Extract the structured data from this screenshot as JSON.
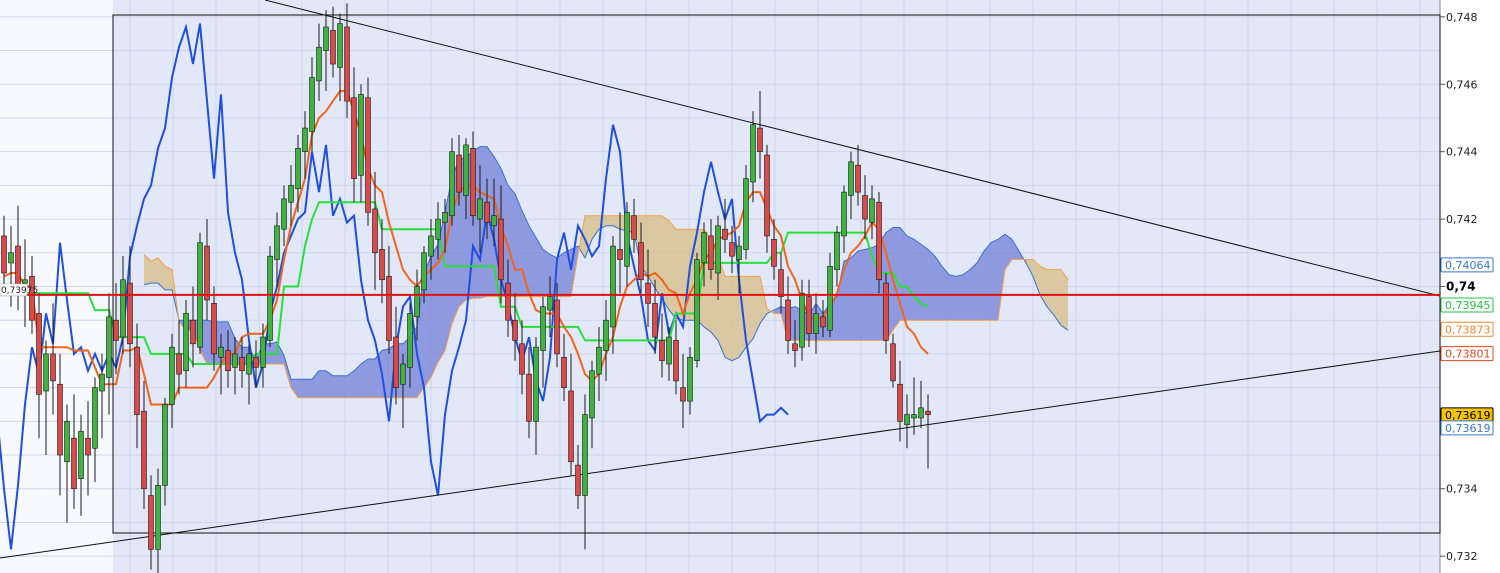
{
  "chart_data": {
    "type": "candlestick",
    "ylim": [
      0.7315,
      0.7485
    ],
    "y_ticks": [
      "0,748",
      "0,746",
      "0,744",
      "0,742",
      "0,74",
      "0,734",
      "0,732"
    ],
    "bold_tick": "0,74",
    "grid": true,
    "current_price_line": 0.73975,
    "price_tags": [
      {
        "label": "0,74064",
        "value": 0.74064,
        "color": "#3a78d0",
        "fill": "#ffffff"
      },
      {
        "label": "0,73945",
        "value": 0.73945,
        "color": "#22c444",
        "fill": "#ffffff"
      },
      {
        "label": "0,73873",
        "value": 0.73873,
        "color": "#f08a2e",
        "fill": "#ffffff"
      },
      {
        "label": "0,73801",
        "value": 0.73801,
        "color": "#e04a1a",
        "fill": "#ffffff"
      },
      {
        "label": "0,73619",
        "value": 0.73619,
        "color": "#000000",
        "fill": "#f5c400"
      },
      {
        "label": "0,73619",
        "value": 0.73619,
        "color": "#3a78d0",
        "fill": "#ffffff"
      }
    ],
    "left_tag": "0,73975",
    "series": [
      {
        "name": "price",
        "ohlc": [
          [
            0.7415,
            0.7421,
            0.7398,
            0.7404
          ],
          [
            0.7407,
            0.7418,
            0.7394,
            0.741
          ],
          [
            0.7412,
            0.7424,
            0.7393,
            0.7399
          ],
          [
            0.7401,
            0.7414,
            0.7388,
            0.7402
          ],
          [
            0.7403,
            0.7409,
            0.7386,
            0.739
          ],
          [
            0.7392,
            0.7398,
            0.7355,
            0.7368
          ],
          [
            0.7369,
            0.7384,
            0.735,
            0.738
          ],
          [
            0.738,
            0.7395,
            0.7362,
            0.7372
          ],
          [
            0.7371,
            0.738,
            0.7338,
            0.735
          ],
          [
            0.7348,
            0.7365,
            0.733,
            0.736
          ],
          [
            0.7355,
            0.7368,
            0.7334,
            0.734
          ],
          [
            0.7343,
            0.7362,
            0.7332,
            0.7357
          ],
          [
            0.7355,
            0.7366,
            0.7338,
            0.735
          ],
          [
            0.7352,
            0.7373,
            0.7342,
            0.737
          ],
          [
            0.7369,
            0.738,
            0.7355,
            0.7374
          ],
          [
            0.7373,
            0.7398,
            0.7362,
            0.7391
          ],
          [
            0.739,
            0.7401,
            0.7374,
            0.7384
          ],
          [
            0.7385,
            0.7409,
            0.738,
            0.7402
          ],
          [
            0.7401,
            0.7412,
            0.7376,
            0.7383
          ],
          [
            0.7382,
            0.7389,
            0.7352,
            0.7362
          ],
          [
            0.7363,
            0.7372,
            0.7334,
            0.734
          ],
          [
            0.7338,
            0.7344,
            0.7316,
            0.7322
          ],
          [
            0.7322,
            0.7346,
            0.731,
            0.7341
          ],
          [
            0.7341,
            0.7367,
            0.7335,
            0.7365
          ],
          [
            0.7365,
            0.7386,
            0.7358,
            0.7382
          ],
          [
            0.738,
            0.739,
            0.7368,
            0.7374
          ],
          [
            0.7375,
            0.7396,
            0.737,
            0.7392
          ],
          [
            0.739,
            0.74,
            0.7376,
            0.7383
          ],
          [
            0.7382,
            0.7416,
            0.738,
            0.7413
          ],
          [
            0.7412,
            0.742,
            0.739,
            0.7396
          ],
          [
            0.7395,
            0.74,
            0.7375,
            0.738
          ],
          [
            0.7379,
            0.7386,
            0.7368,
            0.7382
          ],
          [
            0.7381,
            0.7387,
            0.737,
            0.7375
          ],
          [
            0.7376,
            0.7385,
            0.7368,
            0.738
          ],
          [
            0.7379,
            0.7385,
            0.737,
            0.7375
          ],
          [
            0.7374,
            0.7383,
            0.7365,
            0.738
          ],
          [
            0.7379,
            0.7384,
            0.737,
            0.7376
          ],
          [
            0.7376,
            0.7389,
            0.737,
            0.7385
          ],
          [
            0.7384,
            0.7412,
            0.7382,
            0.7409
          ],
          [
            0.7408,
            0.7422,
            0.74,
            0.7418
          ],
          [
            0.7417,
            0.743,
            0.7412,
            0.7426
          ],
          [
            0.7425,
            0.7436,
            0.7418,
            0.743
          ],
          [
            0.7429,
            0.7445,
            0.7422,
            0.7441
          ],
          [
            0.744,
            0.7452,
            0.7432,
            0.7447
          ],
          [
            0.7446,
            0.7468,
            0.744,
            0.7462
          ],
          [
            0.7461,
            0.7478,
            0.7455,
            0.7471
          ],
          [
            0.747,
            0.7482,
            0.7458,
            0.7477
          ],
          [
            0.7476,
            0.7483,
            0.7462,
            0.7466
          ],
          [
            0.7465,
            0.7481,
            0.7455,
            0.7478
          ],
          [
            0.7477,
            0.7484,
            0.745,
            0.7455
          ],
          [
            0.7456,
            0.7465,
            0.7425,
            0.7432
          ],
          [
            0.7433,
            0.746,
            0.7425,
            0.7457
          ],
          [
            0.7456,
            0.7462,
            0.7418,
            0.7422
          ],
          [
            0.7423,
            0.7434,
            0.7399,
            0.741
          ],
          [
            0.7411,
            0.742,
            0.7395,
            0.7402
          ],
          [
            0.7403,
            0.7412,
            0.738,
            0.7384
          ],
          [
            0.7385,
            0.7394,
            0.7365,
            0.737
          ],
          [
            0.7371,
            0.738,
            0.7358,
            0.7377
          ],
          [
            0.7376,
            0.7395,
            0.737,
            0.7392
          ],
          [
            0.7391,
            0.7405,
            0.7384,
            0.74
          ],
          [
            0.7399,
            0.7412,
            0.7395,
            0.741
          ],
          [
            0.7409,
            0.742,
            0.7402,
            0.7415
          ],
          [
            0.7414,
            0.7425,
            0.7408,
            0.742
          ],
          [
            0.7419,
            0.7426,
            0.741,
            0.7422
          ],
          [
            0.7421,
            0.7444,
            0.7418,
            0.744
          ],
          [
            0.7439,
            0.7445,
            0.7424,
            0.7428
          ],
          [
            0.7427,
            0.7444,
            0.742,
            0.7442
          ],
          [
            0.7441,
            0.7446,
            0.7418,
            0.7421
          ],
          [
            0.742,
            0.7436,
            0.741,
            0.7426
          ],
          [
            0.7425,
            0.7432,
            0.7414,
            0.7419
          ],
          [
            0.7418,
            0.7432,
            0.7412,
            0.7421
          ],
          [
            0.742,
            0.743,
            0.7395,
            0.7402
          ],
          [
            0.7401,
            0.7408,
            0.7385,
            0.739
          ],
          [
            0.739,
            0.7398,
            0.7378,
            0.7384
          ],
          [
            0.7383,
            0.739,
            0.7368,
            0.7374
          ],
          [
            0.7374,
            0.7382,
            0.7355,
            0.736
          ],
          [
            0.736,
            0.7385,
            0.735,
            0.7382
          ],
          [
            0.7381,
            0.7397,
            0.737,
            0.7394
          ],
          [
            0.7393,
            0.7403,
            0.7385,
            0.7397
          ],
          [
            0.7396,
            0.7401,
            0.7376,
            0.738
          ],
          [
            0.7379,
            0.7386,
            0.7366,
            0.737
          ],
          [
            0.7369,
            0.738,
            0.7344,
            0.7348
          ],
          [
            0.7347,
            0.7353,
            0.7334,
            0.7338
          ],
          [
            0.7338,
            0.7368,
            0.7322,
            0.7362
          ],
          [
            0.7361,
            0.7378,
            0.7352,
            0.7375
          ],
          [
            0.7374,
            0.7388,
            0.7366,
            0.7382
          ],
          [
            0.7381,
            0.7396,
            0.7372,
            0.739
          ],
          [
            0.7388,
            0.7415,
            0.738,
            0.7412
          ],
          [
            0.7411,
            0.7422,
            0.7398,
            0.7408
          ],
          [
            0.7406,
            0.7425,
            0.74,
            0.7422
          ],
          [
            0.7421,
            0.7426,
            0.741,
            0.7414
          ],
          [
            0.7413,
            0.7419,
            0.7398,
            0.7402
          ],
          [
            0.7401,
            0.7411,
            0.7388,
            0.7395
          ],
          [
            0.7395,
            0.7402,
            0.738,
            0.7385
          ],
          [
            0.7384,
            0.7392,
            0.7373,
            0.7378
          ],
          [
            0.7377,
            0.7388,
            0.7372,
            0.7385
          ],
          [
            0.7384,
            0.739,
            0.7368,
            0.7372
          ],
          [
            0.737,
            0.738,
            0.7358,
            0.7366
          ],
          [
            0.7366,
            0.7382,
            0.7362,
            0.7379
          ],
          [
            0.7378,
            0.741,
            0.7376,
            0.7408
          ],
          [
            0.7407,
            0.7419,
            0.74,
            0.7416
          ],
          [
            0.7415,
            0.742,
            0.7402,
            0.7405
          ],
          [
            0.7404,
            0.7421,
            0.7396,
            0.7418
          ],
          [
            0.7417,
            0.7426,
            0.741,
            0.7414
          ],
          [
            0.7413,
            0.7418,
            0.7404,
            0.7409
          ],
          [
            0.7408,
            0.7415,
            0.7398,
            0.7412
          ],
          [
            0.7411,
            0.7436,
            0.7408,
            0.7432
          ],
          [
            0.7431,
            0.7452,
            0.7425,
            0.7448
          ],
          [
            0.7447,
            0.7458,
            0.7432,
            0.744
          ],
          [
            0.7439,
            0.7442,
            0.741,
            0.7415
          ],
          [
            0.7414,
            0.742,
            0.7402,
            0.7406
          ],
          [
            0.7405,
            0.741,
            0.7392,
            0.7397
          ],
          [
            0.7396,
            0.7403,
            0.738,
            0.7384
          ],
          [
            0.7383,
            0.739,
            0.7376,
            0.7381
          ],
          [
            0.7382,
            0.7402,
            0.7378,
            0.7398
          ],
          [
            0.7397,
            0.7402,
            0.7382,
            0.7386
          ],
          [
            0.7386,
            0.7398,
            0.738,
            0.7392
          ],
          [
            0.7391,
            0.7396,
            0.7385,
            0.7388
          ],
          [
            0.7387,
            0.741,
            0.7385,
            0.7406
          ],
          [
            0.7405,
            0.7418,
            0.74,
            0.7416
          ],
          [
            0.7415,
            0.743,
            0.741,
            0.7428
          ],
          [
            0.7427,
            0.744,
            0.742,
            0.7437
          ],
          [
            0.7436,
            0.7442,
            0.7424,
            0.7428
          ],
          [
            0.7427,
            0.7433,
            0.7414,
            0.742
          ],
          [
            0.7419,
            0.743,
            0.7414,
            0.7426
          ],
          [
            0.7425,
            0.7428,
            0.7398,
            0.7402
          ],
          [
            0.7401,
            0.7404,
            0.738,
            0.7384
          ],
          [
            0.7383,
            0.7386,
            0.737,
            0.7372
          ],
          [
            0.7371,
            0.7378,
            0.7354,
            0.736
          ],
          [
            0.7359,
            0.7368,
            0.7352,
            0.7362
          ],
          [
            0.7361,
            0.7373,
            0.7356,
            0.7362
          ],
          [
            0.7361,
            0.7372,
            0.7358,
            0.7364
          ],
          [
            0.7363,
            0.7368,
            0.7346,
            0.7362
          ]
        ]
      },
      {
        "name": "tenkan",
        "values": [
          0.7403,
          0.7404,
          0.7404,
          0.74,
          0.74,
          0.7382,
          0.7382,
          0.7382,
          0.7382,
          0.7382,
          0.7381,
          0.7381,
          0.7381,
          0.7376,
          0.7371,
          0.7371,
          0.7371,
          0.7381,
          0.7381,
          0.7382,
          0.7374,
          0.7365,
          0.7365,
          0.7365,
          0.7365,
          0.737,
          0.737,
          0.737,
          0.737,
          0.737,
          0.7373,
          0.7377,
          0.738,
          0.738,
          0.7385,
          0.7386,
          0.7386,
          0.7386,
          0.739,
          0.7396,
          0.7408,
          0.7418,
          0.7425,
          0.7432,
          0.7445,
          0.745,
          0.7452,
          0.7455,
          0.7458,
          0.7458,
          0.7452,
          0.7445,
          0.7435,
          0.743,
          0.7428,
          0.7419,
          0.7412,
          0.7405,
          0.7402,
          0.74,
          0.7403,
          0.7405,
          0.7407,
          0.7411,
          0.7422,
          0.7428,
          0.743,
          0.743,
          0.7428,
          0.7427,
          0.7426,
          0.7418,
          0.7412,
          0.7405,
          0.7405,
          0.7398,
          0.7393,
          0.7392,
          0.7392,
          0.7392,
          0.7388,
          0.7385,
          0.738,
          0.7374,
          0.7372,
          0.7374,
          0.738,
          0.7385,
          0.7394,
          0.74,
          0.7402,
          0.7404,
          0.7403,
          0.7404,
          0.7402,
          0.7399,
          0.7398,
          0.7392,
          0.7398,
          0.7402,
          0.7408,
          0.741,
          0.7414,
          0.7415,
          0.7416,
          0.7418,
          0.7425,
          0.7428,
          0.7428,
          0.7423,
          0.7418,
          0.7415,
          0.7406,
          0.7402,
          0.7396,
          0.7391,
          0.739,
          0.7391,
          0.7394,
          0.7398,
          0.7405,
          0.741,
          0.7412,
          0.7415,
          0.7419,
          0.7417,
          0.741,
          0.7402,
          0.7395,
          0.7388,
          0.7386,
          0.7382,
          0.738
        ]
      },
      {
        "name": "kijun",
        "values": [
          0.7398,
          0.7398,
          0.7398,
          0.7398,
          0.7398,
          0.7398,
          0.7398,
          0.7398,
          0.7398,
          0.7398,
          0.7398,
          0.7398,
          0.7398,
          0.7393,
          0.7393,
          0.7393,
          0.7385,
          0.7385,
          0.7385,
          0.7385,
          0.7385,
          0.738,
          0.738,
          0.738,
          0.738,
          0.738,
          0.738,
          0.7377,
          0.7377,
          0.7377,
          0.7377,
          0.7377,
          0.7377,
          0.7377,
          0.7377,
          0.7377,
          0.738,
          0.738,
          0.738,
          0.738,
          0.74,
          0.74,
          0.74,
          0.7412,
          0.742,
          0.7425,
          0.7425,
          0.7425,
          0.7425,
          0.7425,
          0.7425,
          0.7425,
          0.7425,
          0.7425,
          0.7417,
          0.7417,
          0.7417,
          0.7417,
          0.7417,
          0.7417,
          0.7417,
          0.7417,
          0.7417,
          0.7406,
          0.7406,
          0.7406,
          0.7406,
          0.7406,
          0.7406,
          0.7406,
          0.7406,
          0.7394,
          0.7394,
          0.7394,
          0.7388,
          0.7388,
          0.7388,
          0.7388,
          0.7388,
          0.7388,
          0.7388,
          0.7388,
          0.7388,
          0.7384,
          0.7384,
          0.7384,
          0.7384,
          0.7384,
          0.7384,
          0.7384,
          0.7384,
          0.7384,
          0.7384,
          0.7384,
          0.7384,
          0.7384,
          0.7392,
          0.7392,
          0.7392,
          0.7392,
          0.7407,
          0.7407,
          0.7407,
          0.7407,
          0.7407,
          0.7407,
          0.7407,
          0.7407,
          0.7407,
          0.7407,
          0.741,
          0.741,
          0.7416,
          0.7416,
          0.7416,
          0.7416,
          0.7416,
          0.7416,
          0.7416,
          0.7416,
          0.7416,
          0.7416,
          0.7416,
          0.7416,
          0.7409,
          0.7404,
          0.7404,
          0.7404,
          0.74,
          0.74,
          0.7397,
          0.7395,
          0.7394
        ]
      }
    ]
  }
}
